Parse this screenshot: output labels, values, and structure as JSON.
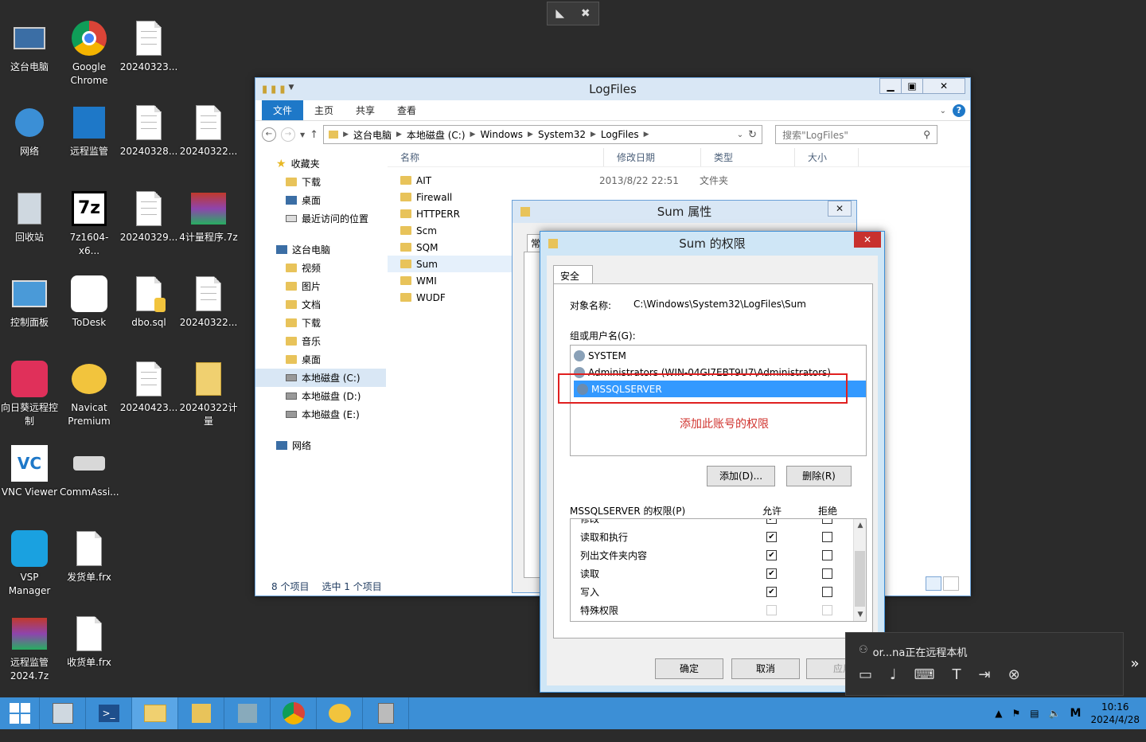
{
  "desktop_icons": [
    {
      "label": "这台电脑"
    },
    {
      "label": "Google Chrome"
    },
    {
      "label": "20240323..."
    },
    {
      "label": "网络"
    },
    {
      "label": "远程监管"
    },
    {
      "label": "20240328..."
    },
    {
      "label": "20240322..."
    },
    {
      "label": "回收站"
    },
    {
      "label": "7z1604-x6..."
    },
    {
      "label": "20240329..."
    },
    {
      "label": "4计量程序.7z"
    },
    {
      "label": "控制面板"
    },
    {
      "label": "ToDesk"
    },
    {
      "label": "dbo.sql"
    },
    {
      "label": "20240322..."
    },
    {
      "label": "向日葵远程控制"
    },
    {
      "label": "Navicat Premium"
    },
    {
      "label": "20240423..."
    },
    {
      "label": "20240322计量"
    },
    {
      "label": "VNC Viewer"
    },
    {
      "label": "CommAssi..."
    },
    {
      "label": "VSP Manager"
    },
    {
      "label": "发货单.frx"
    },
    {
      "label": "远程监管2024.7z"
    },
    {
      "label": "收货单.frx"
    }
  ],
  "explorer": {
    "title": "LogFiles",
    "ribbon_tabs": [
      "文件",
      "主页",
      "共享",
      "查看"
    ],
    "path": [
      "这台电脑",
      "本地磁盘 (C:)",
      "Windows",
      "System32",
      "LogFiles"
    ],
    "search_placeholder": "搜索\"LogFiles\"",
    "columns": [
      "名称",
      "修改日期",
      "类型",
      "大小"
    ],
    "first_row": {
      "date": "2013/8/22 22:51",
      "type": "文件夹"
    },
    "files": [
      "AIT",
      "Firewall",
      "HTTPERR",
      "Scm",
      "SQM",
      "Sum",
      "WMI",
      "WUDF"
    ],
    "nav": {
      "favorites": "收藏夹",
      "fav_items": [
        "下载",
        "桌面",
        "最近访问的位置"
      ],
      "this_pc": "这台电脑",
      "pc_items": [
        "视频",
        "图片",
        "文档",
        "下载",
        "音乐",
        "桌面"
      ],
      "drives": [
        "本地磁盘 (C:)",
        "本地磁盘 (D:)",
        "本地磁盘 (E:)"
      ],
      "network": "网络"
    },
    "status_count": "8 个项目",
    "status_selected": "选中 1 个项目"
  },
  "props_dialog": {
    "title": "Sum 属性",
    "tab_fragment": "常"
  },
  "perm_dialog": {
    "title": "Sum 的权限",
    "tab": "安全",
    "object_label": "对象名称:",
    "object_value": "C:\\Windows\\System32\\LogFiles\\Sum",
    "group_label": "组或用户名(G):",
    "users": [
      "SYSTEM",
      "Administrators (WIN-04GI7EBT9U7\\Administrators)",
      "MSSQLSERVER"
    ],
    "annotation": "添加此账号的权限",
    "add_button": "添加(D)...",
    "remove_button": "删除(R)",
    "perm_label": "MSSQLSERVER 的权限(P)",
    "allow": "允许",
    "deny": "拒绝",
    "permissions": [
      {
        "name": "修改",
        "allow": true,
        "deny": false
      },
      {
        "name": "读取和执行",
        "allow": true,
        "deny": false
      },
      {
        "name": "列出文件夹内容",
        "allow": true,
        "deny": false
      },
      {
        "name": "读取",
        "allow": true,
        "deny": false
      },
      {
        "name": "写入",
        "allow": true,
        "deny": false
      },
      {
        "name": "特殊权限",
        "allow": false,
        "deny": false
      }
    ],
    "ok": "确定",
    "cancel": "取消",
    "apply": "应用"
  },
  "remote_panel": {
    "status": "or...na正在远程本机"
  },
  "taskbar": {
    "time": "10:16",
    "date": "2024/4/28"
  }
}
